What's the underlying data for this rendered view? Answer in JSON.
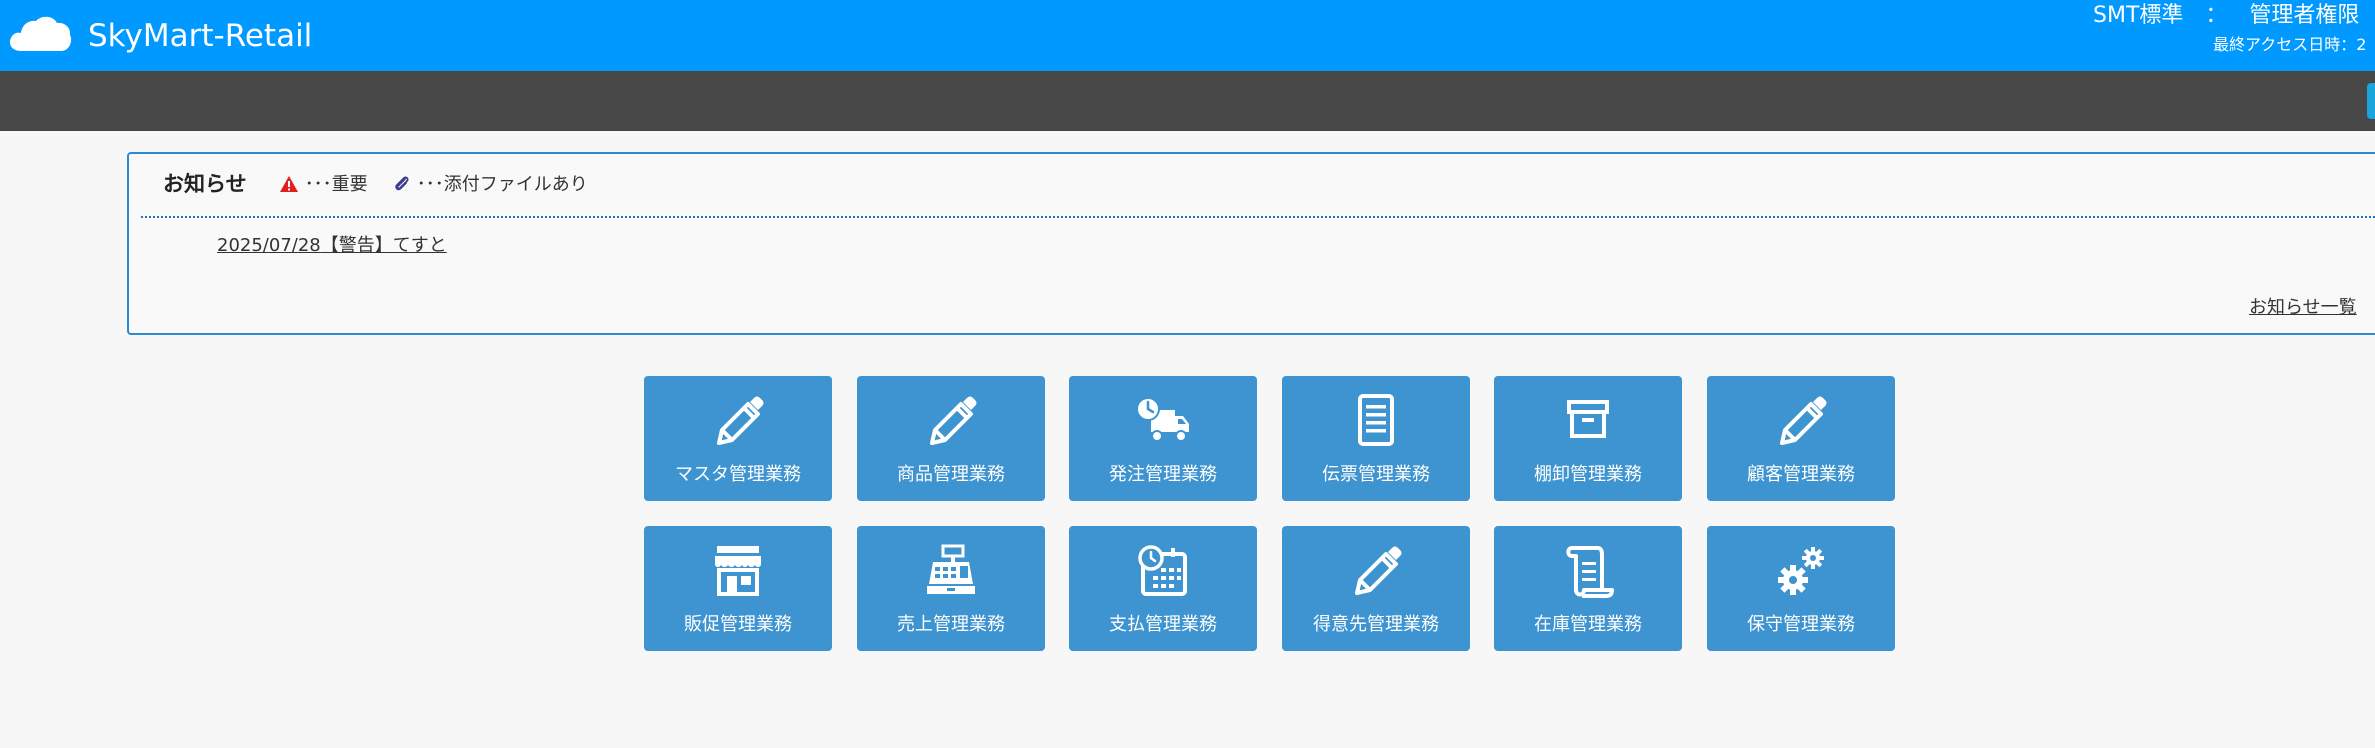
{
  "header": {
    "app_title": "SkyMart-Retail",
    "company": "SMT標準",
    "separator": "：",
    "role": "管理者権限",
    "last_access_label": "最終アクセス日時：2"
  },
  "notice": {
    "title": "お知らせ",
    "legend_important": "･･･重要",
    "legend_attachment": "･･･添付ファイルあり",
    "items": [
      {
        "date": "2025/07/28",
        "text": "【警告】てすと"
      }
    ],
    "view_all": "お知らせ一覧"
  },
  "menu": {
    "tiles": [
      {
        "label": "マスタ管理業務",
        "icon": "pencil-icon"
      },
      {
        "label": "商品管理業務",
        "icon": "pencil-icon"
      },
      {
        "label": "発注管理業務",
        "icon": "delivery-truck-icon"
      },
      {
        "label": "伝票管理業務",
        "icon": "document-icon"
      },
      {
        "label": "棚卸管理業務",
        "icon": "archive-box-icon"
      },
      {
        "label": "顧客管理業務",
        "icon": "pencil-icon"
      },
      {
        "label": "販促管理業務",
        "icon": "store-icon"
      },
      {
        "label": "売上管理業務",
        "icon": "cash-register-icon"
      },
      {
        "label": "支払管理業務",
        "icon": "calendar-clock-icon"
      },
      {
        "label": "得意先管理業務",
        "icon": "pencil-icon"
      },
      {
        "label": "在庫管理業務",
        "icon": "scroll-icon"
      },
      {
        "label": "保守管理業務",
        "icon": "gears-icon"
      }
    ]
  },
  "colors": {
    "header_bg": "#0099ff",
    "subbar_bg": "#474747",
    "tile_bg": "#3d94d0",
    "notice_border": "#2b8ad0",
    "important_red": "#e02020"
  }
}
